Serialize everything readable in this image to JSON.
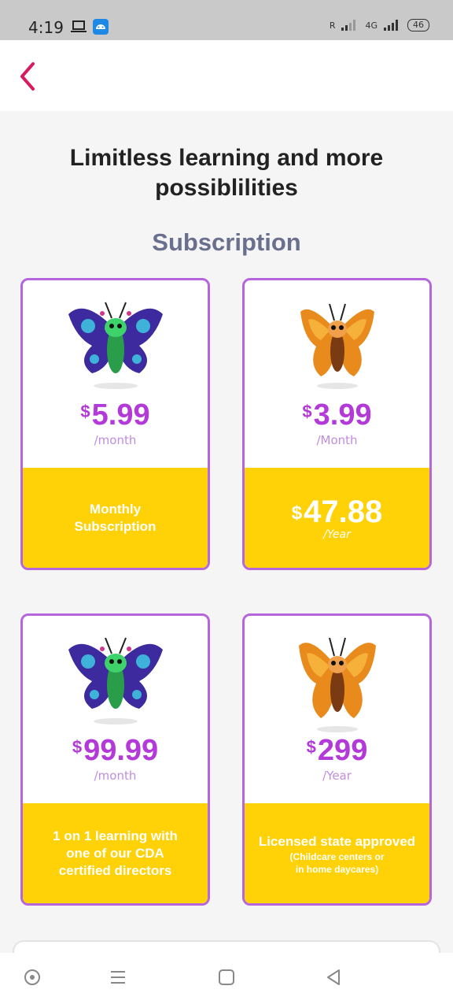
{
  "status_bar": {
    "time": "4:19",
    "signal_text": "R",
    "network": "4G",
    "battery": "46"
  },
  "header": {
    "back_icon": "chevron-left-icon",
    "accent_color": "#d81b60"
  },
  "headline": {
    "line1": "Limitless learning and more",
    "line2": "possiblilities"
  },
  "section_title": "Subscription",
  "plans": [
    {
      "icon": "butterfly-blue-icon",
      "currency": "$",
      "price": "5.99",
      "period": "/month",
      "desc_lines": [
        "Monthly",
        "Subscription"
      ]
    },
    {
      "icon": "butterfly-orange-icon",
      "currency": "$",
      "price": "3.99",
      "period": "/Month",
      "bottom_currency": "$",
      "bottom_price": "47.88",
      "bottom_period": "/Year"
    },
    {
      "icon": "butterfly-blue-icon",
      "currency": "$",
      "price": "99.99",
      "period": "/month",
      "desc_lines": [
        "1 on 1 learning with",
        "one of our CDA",
        "certified directors"
      ]
    },
    {
      "icon": "butterfly-orange-icon",
      "currency": "$",
      "price": "299",
      "period": "/Year",
      "desc_title": "Licensed state approved",
      "desc_sub_lines": [
        "(Childcare centers or",
        "in home daycares)"
      ]
    }
  ],
  "colors": {
    "card_border": "#b566dd",
    "price": "#b33ad9",
    "highlight": "#ffd207"
  },
  "nav": {
    "icons": [
      "assistant-icon",
      "recents-icon",
      "home-icon",
      "back-icon"
    ]
  }
}
